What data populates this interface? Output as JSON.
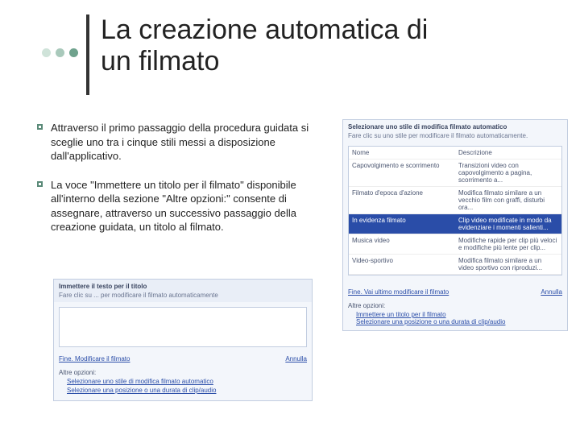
{
  "title": "La creazione automatica di un filmato",
  "bullets": {
    "p1": "Attraverso il primo passaggio della procedura guidata si sceglie uno tra i cinque stili messi a disposizione dall'applicativo.",
    "p2": "La voce \"Immettere un titolo per il filmato\" disponibile all'interno della sezione \"Altre opzioni:\" consente di assegnare, attraverso un successivo passaggio della creazione guidata, un titolo al filmato."
  },
  "wiz1": {
    "heading": "Selezionare uno stile di modifica filmato automatico",
    "sub": "Fare clic su uno stile per modificare il filmato automaticamente.",
    "rows": {
      "r0a": "Nome",
      "r0b": "Descrizione",
      "r1a": "Capovolgimento e scorrimento",
      "r1b": "Transizioni video con capovolgimento a pagina, scorrimento a...",
      "r2a": "Filmato d'epoca d'azione",
      "r2b": "Modifica filmato similare a un vecchio film con graffi, disturbi ora...",
      "r3a": "In evidenza filmato",
      "r3b": "Clip video modificate in modo da evidenziare i momenti salienti...",
      "r4a": "Musica video",
      "r4b": "Modifiche rapide per clip più veloci e modifiche più lente per clip...",
      "r5a": "Video-sportivo",
      "r5b": "Modifica filmato similare a un video sportivo con riproduzi..."
    },
    "nav_back": "Fine. Vai ultimo modificare il filmato",
    "nav_cancel": "Annulla",
    "opts_label": "Altre opzioni:",
    "opt1": "Immettere un titolo per il filmato",
    "opt2": "Selezionare una posizione o una durata di clip/audio"
  },
  "wiz2": {
    "heading": "Immettere il testo per il titolo",
    "sub": "Fare clic su ... per modificare il filmato automaticamente",
    "nav_back": "Fine. Modificare il filmato",
    "nav_cancel": "Annulla",
    "opts_label": "Altre opzioni:",
    "opt1": "Selezionare uno stile di modifica filmato automatico",
    "opt2": "Selezionare una posizione o una durata di clip/audio"
  }
}
